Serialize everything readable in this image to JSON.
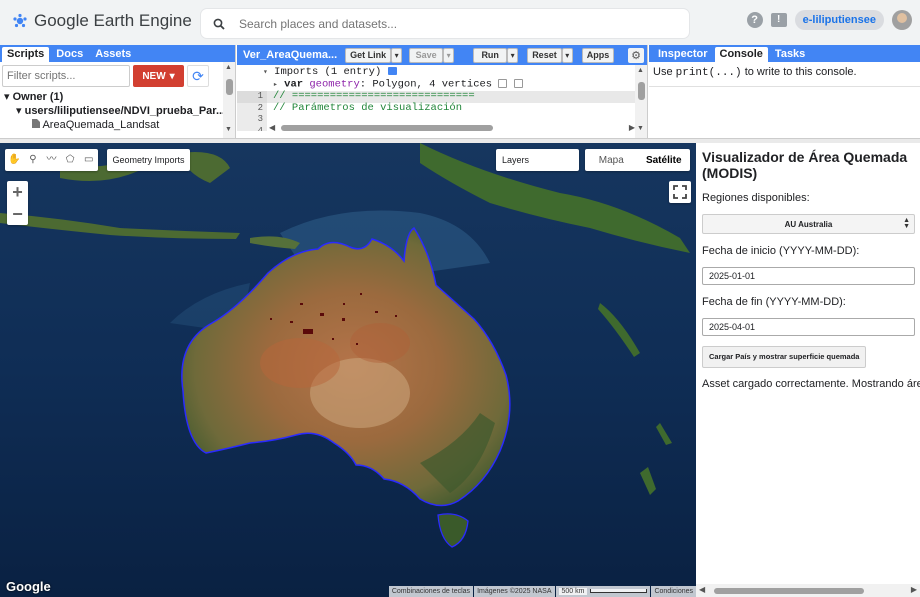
{
  "app": {
    "logo_text": "Google Earth Engine",
    "search_placeholder": "Search places and datasets...",
    "help_icon": "?",
    "feedback_icon": "!",
    "user": "e-liliputiensee"
  },
  "left_panel": {
    "tabs": [
      {
        "label": "Scripts",
        "active": true
      },
      {
        "label": "Docs",
        "active": false
      },
      {
        "label": "Assets",
        "active": false
      }
    ],
    "filter_placeholder": "Filter scripts...",
    "new_label": "NEW",
    "new_caret": "▾",
    "refresh_glyph": "⟳",
    "tree": [
      {
        "label": "Owner (1)",
        "indent": 0,
        "toggle": "▾"
      },
      {
        "label": "users/liliputiensee/NDVI_prueba_Par...",
        "indent": 1,
        "toggle": "▾"
      },
      {
        "label": "AreaQuemada_Landsat",
        "indent": 2,
        "toggle": ""
      }
    ]
  },
  "editor": {
    "file_name": "Ver_AreaQuema...",
    "buttons": {
      "get_link": "Get Link",
      "save": "Save",
      "run": "Run",
      "reset": "Reset",
      "apps": "Apps"
    },
    "caret": "▾",
    "gear": "⚙",
    "imports_header": "Imports (1 entry)",
    "import_entry": {
      "keyword": "var",
      "name": "geometry",
      "desc": ": Polygon, 4 vertices"
    },
    "lines": [
      {
        "num": "1",
        "text": "// =============================",
        "active": true
      },
      {
        "num": "2",
        "text": "// Parámetros de visualización",
        "active": false
      },
      {
        "num": "3",
        "text": "",
        "active": false
      },
      {
        "num": "4",
        "text": "",
        "active": false
      }
    ]
  },
  "console_panel": {
    "tabs": [
      {
        "label": "Inspector",
        "active": false
      },
      {
        "label": "Console",
        "active": true
      },
      {
        "label": "Tasks",
        "active": false
      }
    ],
    "hint_pre": "Use ",
    "hint_code": "print(...)",
    "hint_post": " to write to this console."
  },
  "map": {
    "geometry_imports": "Geometry Imports",
    "layers": "Layers",
    "map_types": [
      {
        "label": "Mapa",
        "selected": false
      },
      {
        "label": "Satélite",
        "selected": true
      }
    ],
    "zoom_in": "+",
    "zoom_out": "−",
    "google_logo": "Google",
    "attribution": {
      "shortcuts": "Combinaciones de teclas",
      "imagery": "Imágenes ©2025 NASA",
      "scale": "500 km",
      "terms": "Condiciones"
    },
    "colors": {
      "ocean": "#0d2747",
      "land": "#8a6a3e",
      "boundary": "#2a2aff"
    }
  },
  "side_panel": {
    "title": "Visualizador de Área Quemada (MODIS)",
    "regions_label": "Regiones disponibles:",
    "region_selected": "AU Australia",
    "start_label": "Fecha de inicio (YYYY-MM-DD):",
    "start_value": "2025-01-01",
    "end_label": "Fecha de fin (YYYY-MM-DD):",
    "end_value": "2025-04-01",
    "load_button": "Cargar País y mostrar superficie quemada",
    "status": "Asset cargado correctamente. Mostrando área"
  }
}
